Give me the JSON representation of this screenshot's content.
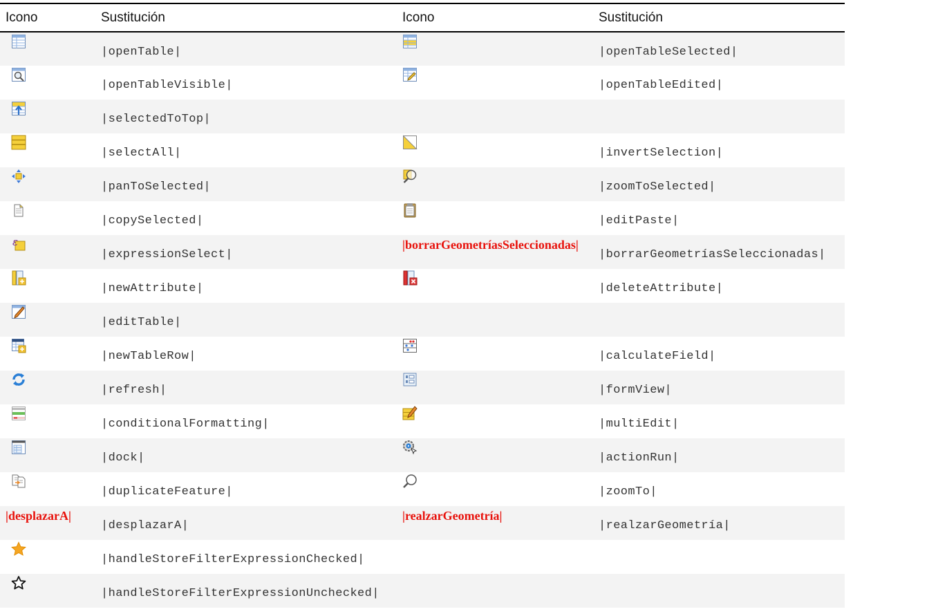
{
  "header": {
    "col1": "Icono",
    "col2": "Sustitución",
    "col3": "Icono",
    "col4": "Sustitución"
  },
  "rows": [
    {
      "i1": "open-table-icon",
      "s1": "|openTable|",
      "i2": "open-table-selected-icon",
      "s2": "|openTableSelected|"
    },
    {
      "i1": "open-table-visible-icon",
      "s1": "|openTableVisible|",
      "i2": "open-table-edited-icon",
      "s2": "|openTableEdited|"
    },
    {
      "i1": "selected-to-top-icon",
      "s1": "|selectedToTop|",
      "i2": "",
      "s2": ""
    },
    {
      "i1": "select-all-icon",
      "s1": "|selectAll|",
      "i2": "invert-selection-icon",
      "s2": "|invertSelection|"
    },
    {
      "i1": "pan-to-selected-icon",
      "s1": "|panToSelected|",
      "i2": "zoom-to-selected-icon",
      "s2": "|zoomToSelected|"
    },
    {
      "i1": "copy-selected-icon",
      "s1": "|copySelected|",
      "i2": "edit-paste-icon",
      "s2": "|editPaste|"
    },
    {
      "i1": "expression-select-icon",
      "s1": "|expressionSelect|",
      "t2": "|borrarGeometríasSeleccionadas|",
      "s2": "|borrarGeometríasSeleccionadas|"
    },
    {
      "i1": "new-attribute-icon",
      "s1": "|newAttribute|",
      "i2": "delete-attribute-icon",
      "s2": "|deleteAttribute|"
    },
    {
      "i1": "edit-table-icon",
      "s1": "|editTable|",
      "i2": "",
      "s2": ""
    },
    {
      "i1": "new-table-row-icon",
      "s1": "|newTableRow|",
      "i2": "calculate-field-icon",
      "s2": "|calculateField|"
    },
    {
      "i1": "refresh-icon",
      "s1": "|refresh|",
      "i2": "form-view-icon",
      "s2": "|formView|"
    },
    {
      "i1": "conditional-formatting-icon",
      "s1": "|conditionalFormatting|",
      "i2": "multi-edit-icon",
      "s2": "|multiEdit|"
    },
    {
      "i1": "dock-icon",
      "s1": "|dock|",
      "i2": "action-run-icon",
      "s2": "|actionRun|"
    },
    {
      "i1": "duplicate-feature-icon",
      "s1": "|duplicateFeature|",
      "i2": "zoom-to-icon",
      "s2": "|zoomTo|"
    },
    {
      "t1": "|desplazarA|",
      "s1": "|desplazarA|",
      "t2": "|realzarGeometría|",
      "s2": "|realzarGeometría|"
    },
    {
      "i1": "star-filled-icon",
      "s1": "|handleStoreFilterExpressionChecked|",
      "i2": "",
      "s2": ""
    },
    {
      "i1": "star-outline-icon",
      "s1": "|handleStoreFilterExpressionUnchecked|",
      "i2": "",
      "s2": ""
    }
  ]
}
